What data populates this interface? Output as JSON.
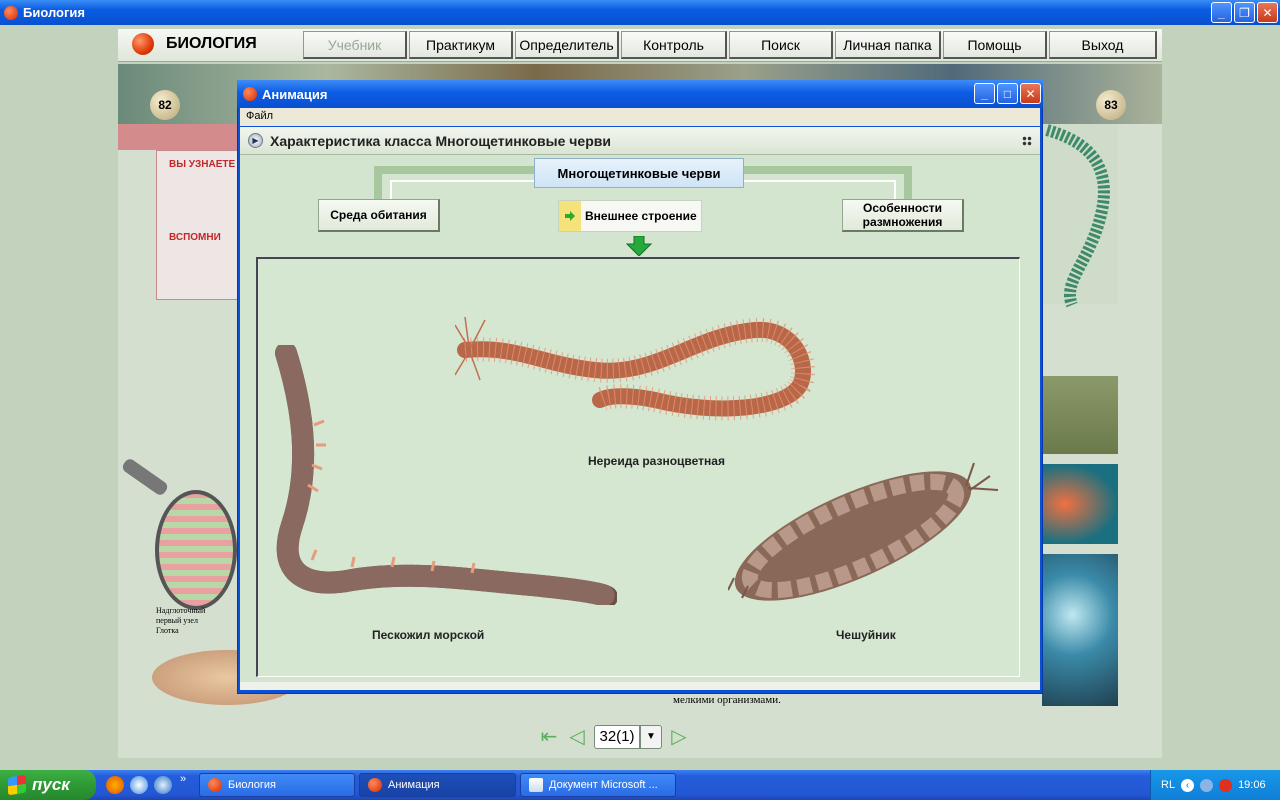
{
  "outer_window": {
    "title": "Биология"
  },
  "app_nav": {
    "brand": "БИОЛОГИЯ",
    "buttons": [
      "Учебник",
      "Практикум",
      "Определитель",
      "Контроль",
      "Поиск",
      "Личная папка",
      "Помощь",
      "Выход"
    ],
    "disabled": "Учебник"
  },
  "textbook": {
    "left_page_number": "82",
    "right_page_number": "83",
    "left_box_heading": "ВЫ УЗНАЕТЕ",
    "left_box_heading2": "ВСПОМНИ",
    "left_labels": [
      "Надглоточный",
      "первый узел",
      "Глотка"
    ],
    "bottom_text": "мелкими организмами.",
    "pager_value": "32(1)"
  },
  "dialog": {
    "title": "Анимация",
    "menu_file": "Файл",
    "header": "Характеристика класса Многощетинковые черви",
    "diagram": {
      "root": "Многощетинковые черви",
      "nodes": [
        "Среда обитания",
        "Внешнее строение",
        "Особенности размножения"
      ],
      "active": "Внешнее строение"
    },
    "animals": [
      {
        "name": "Нереида разноцветная"
      },
      {
        "name": "Пескожил морской"
      },
      {
        "name": "Чешуйник"
      }
    ]
  },
  "taskbar": {
    "start": "пуск",
    "tasks": [
      "Биология",
      "Анимация",
      "Документ Microsoft ..."
    ],
    "lang": "RL",
    "clock": "19:06"
  },
  "colors": {
    "xp_blue": "#0a50d8",
    "start_green": "#2e9a35",
    "diagram_green": "#a7c89f",
    "body_bg": "#d3e4cf"
  }
}
